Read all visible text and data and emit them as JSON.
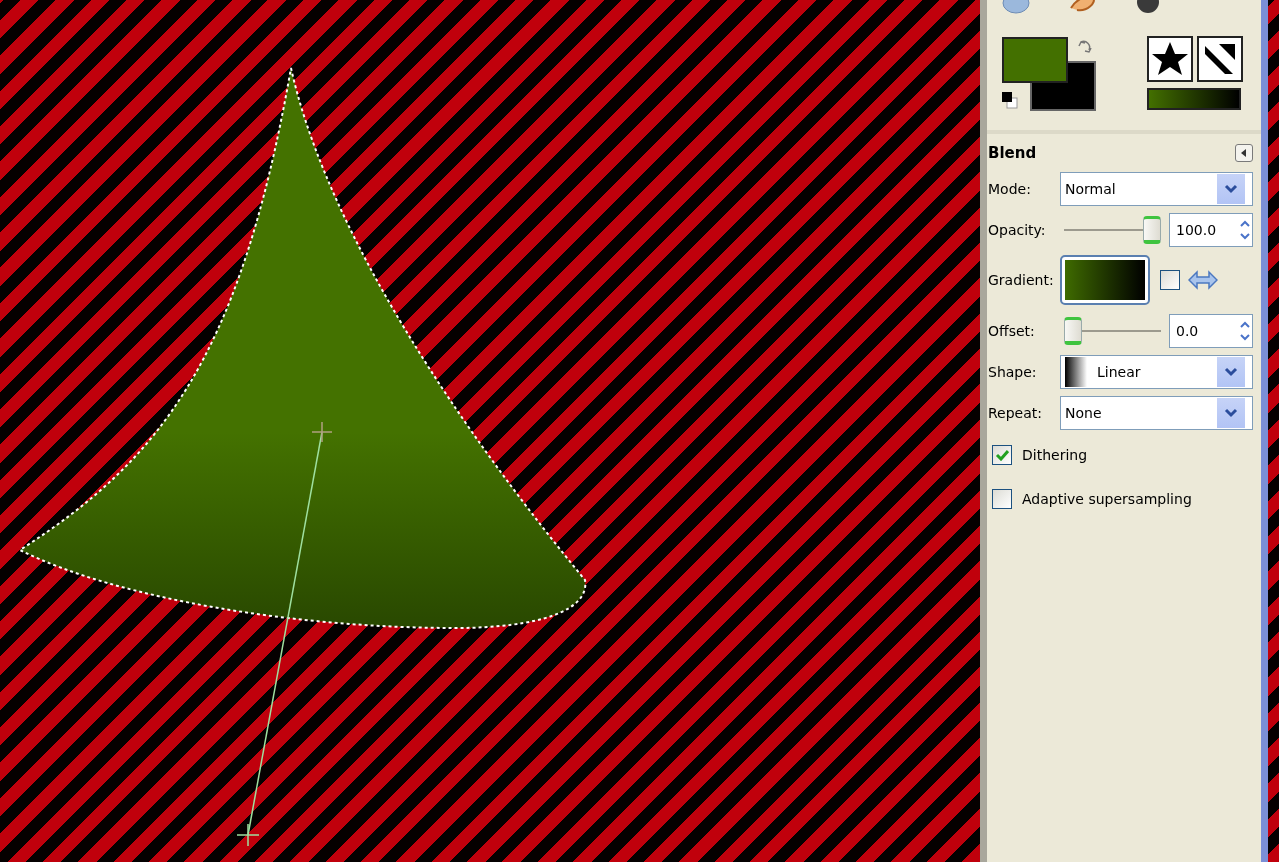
{
  "tool_options": {
    "title": "Blend",
    "mode": {
      "label": "Mode:",
      "value": "Normal"
    },
    "opacity": {
      "label": "Opacity:",
      "level": 1,
      "reading": "100.0"
    },
    "gradient": {
      "label": "Gradient:",
      "reverse": false
    },
    "offset": {
      "label": "Offset:",
      "level": 0,
      "reading": "0.0"
    },
    "shape": {
      "label": "Shape:",
      "value": "Linear"
    },
    "repeat": {
      "label": "Repeat:",
      "value": "None"
    },
    "options": [
      {
        "label": "Dithering",
        "checked": true
      },
      {
        "label": "Adaptive supersampling",
        "checked": false
      }
    ]
  }
}
